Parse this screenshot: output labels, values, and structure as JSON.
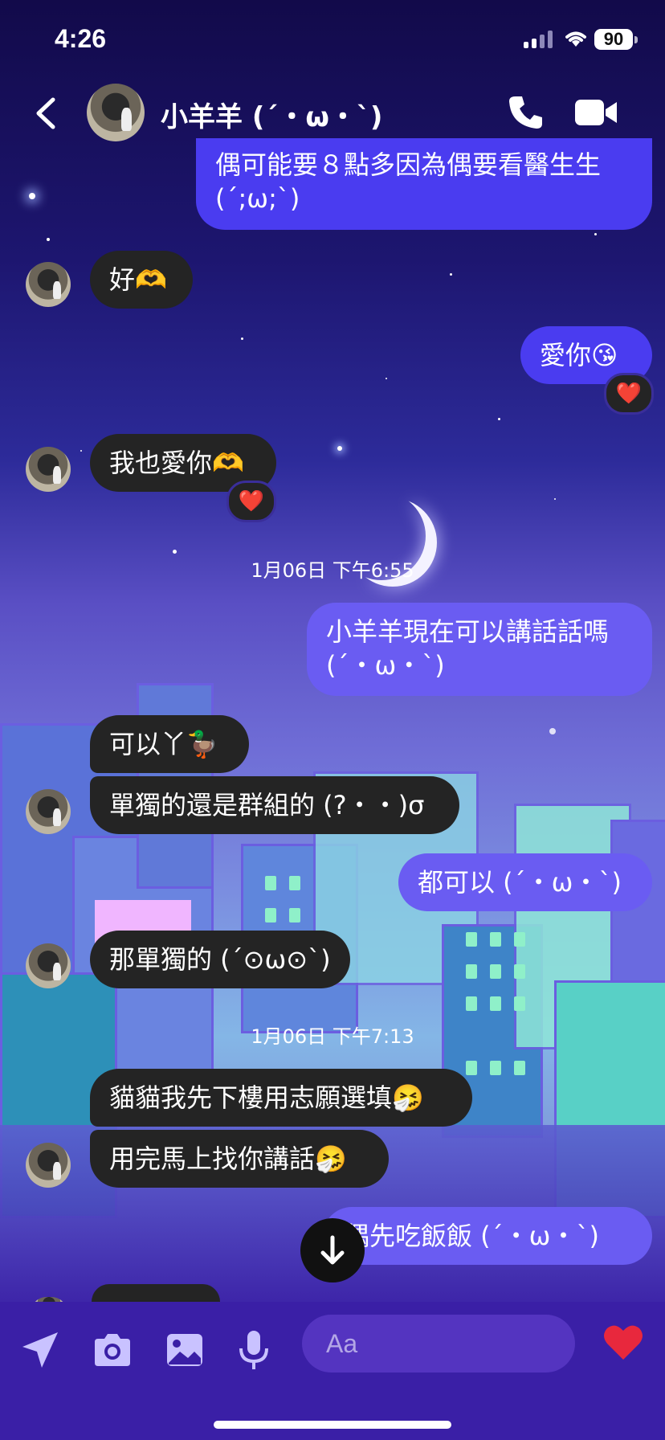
{
  "status_bar": {
    "time": "4:26",
    "battery": "90"
  },
  "header": {
    "contact_name": "小羊羊 (´・ω・`)"
  },
  "messages": [
    {
      "dir": "out",
      "text_l1": "偶可能要８點多因為偶要看醫生生",
      "text_l2": "(´;ω;`)"
    },
    {
      "dir": "in",
      "text": "好🫶"
    },
    {
      "dir": "out",
      "text": "愛你😘",
      "reaction": "❤️"
    },
    {
      "dir": "in",
      "text": "我也愛你🫶",
      "reaction": "❤️"
    },
    {
      "dir": "out",
      "text_l1": "小羊羊現在可以講話話嗎",
      "text_l2": "(´・ω・`)"
    },
    {
      "dir": "in",
      "text": "可以丫🦆"
    },
    {
      "dir": "in",
      "text": "單獨的還是群組的 (?・・)σ"
    },
    {
      "dir": "out",
      "text": "都可以 (´・ω・`)"
    },
    {
      "dir": "in",
      "text": "那單獨的 (´⊙ω⊙`)"
    },
    {
      "dir": "in",
      "text": "貓貓我先下樓用志願選填🤧"
    },
    {
      "dir": "in",
      "text": "用完馬上找你講話🤧"
    },
    {
      "dir": "out",
      "text": "偶先吃飯飯 (´・ω・`)"
    }
  ],
  "timestamps": [
    "1月06日 下午6:55",
    "1月06日 下午7:13"
  ],
  "composer": {
    "placeholder": "Aa",
    "like": "❤️"
  },
  "icons": [
    "back-icon",
    "phone-icon",
    "video-icon",
    "location-icon",
    "camera-icon",
    "photo-icon",
    "mic-icon",
    "emoji-icon",
    "heart-icon",
    "arrow-down-icon"
  ]
}
